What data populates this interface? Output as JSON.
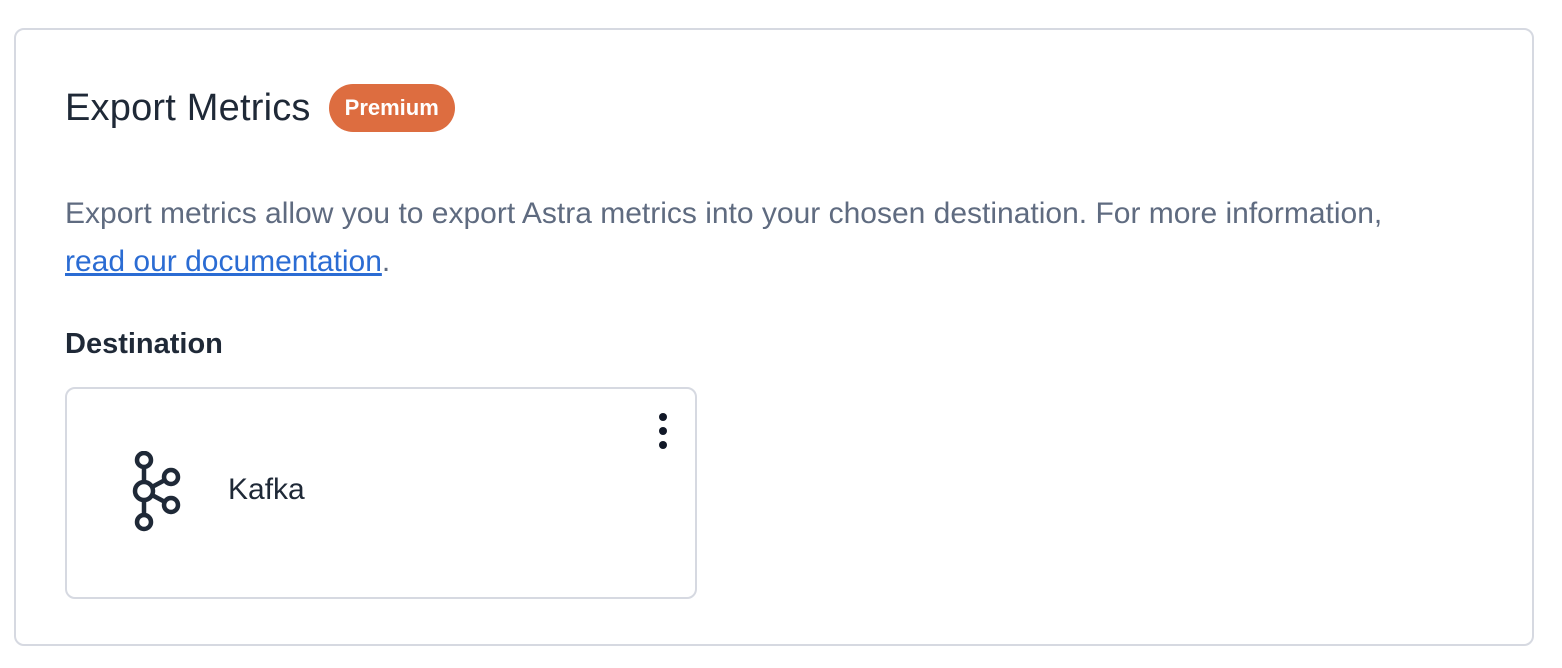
{
  "panel": {
    "title": "Export Metrics",
    "badge": "Premium",
    "description_prefix": "Export metrics allow you to export Astra metrics into your chosen destination. For more information, ",
    "doc_link_text": "read our documentation",
    "description_suffix": "."
  },
  "destination": {
    "label": "Destination",
    "item": {
      "name": "Kafka",
      "icon": "kafka-icon",
      "menu_icon": "more-vertical-icon"
    }
  },
  "colors": {
    "badge_bg": "#dd6d40",
    "link": "#2b6cd3",
    "border": "#d6d9e1",
    "text_primary": "#1f2937",
    "text_secondary": "#5f6b80"
  }
}
